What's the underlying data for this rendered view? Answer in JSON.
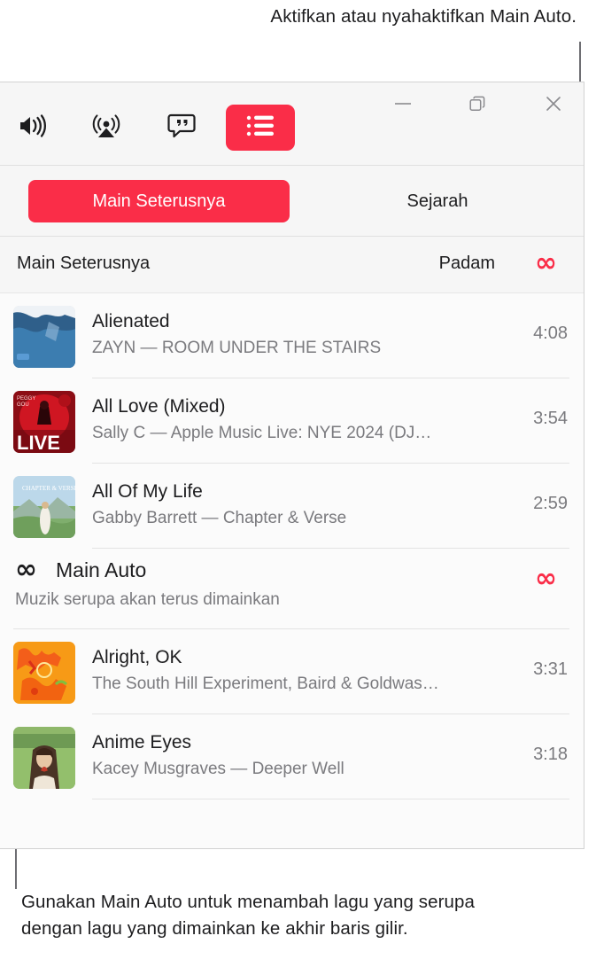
{
  "annotations": {
    "top": "Aktifkan atau nyahaktifkan Main Auto.",
    "bottom": "Gunakan Main Auto untuk menambah lagu yang serupa dengan lagu yang dimainkan ke akhir baris gilir."
  },
  "toolbar": {
    "volume_icon": "volume-icon",
    "airplay_icon": "airplay-icon",
    "lyrics_icon": "lyrics-icon",
    "queue_icon": "queue-list-icon",
    "minimize_label": "—",
    "maximize_label": "restore-icon",
    "close_label": "✕"
  },
  "tabs": [
    {
      "label": "Main Seterusnya",
      "selected": true
    },
    {
      "label": "Sejarah",
      "selected": false
    }
  ],
  "queue_header": {
    "title": "Main Seterusnya",
    "clear_label": "Padam",
    "autoplay_icon": "∞"
  },
  "tracks": [
    {
      "title": "Alienated",
      "subtitle": "ZAYN — ROOM UNDER THE STAIRS",
      "duration": "4:08",
      "art": "alienated-artwork"
    },
    {
      "title": "All Love (Mixed)",
      "subtitle": "Sally C — Apple Music Live: NYE 2024 (DJ…",
      "duration": "3:54",
      "art": "all-love-artwork"
    },
    {
      "title": "All Of My Life",
      "subtitle": "Gabby Barrett — Chapter & Verse",
      "duration": "2:59",
      "art": "all-of-my-life-artwork"
    }
  ],
  "autoplay": {
    "icon": "∞",
    "title": "Main Auto",
    "description": "Muzik serupa akan terus dimainkan",
    "toggle_icon": "∞"
  },
  "autoplay_tracks": [
    {
      "title": "Alright, OK",
      "subtitle": "The South Hill Experiment, Baird & Goldwas…",
      "duration": "3:31",
      "art": "alright-ok-artwork"
    },
    {
      "title": "Anime Eyes",
      "subtitle": "Kacey Musgraves — Deeper Well",
      "duration": "3:18",
      "art": "anime-eyes-artwork"
    }
  ],
  "colors": {
    "accent_red": "#FA2D48",
    "text_primary": "#1D1D1F",
    "text_secondary": "#7A7A7E",
    "window_bg": "#FBFBFB",
    "toolbar_bg": "#F6F6F6"
  }
}
